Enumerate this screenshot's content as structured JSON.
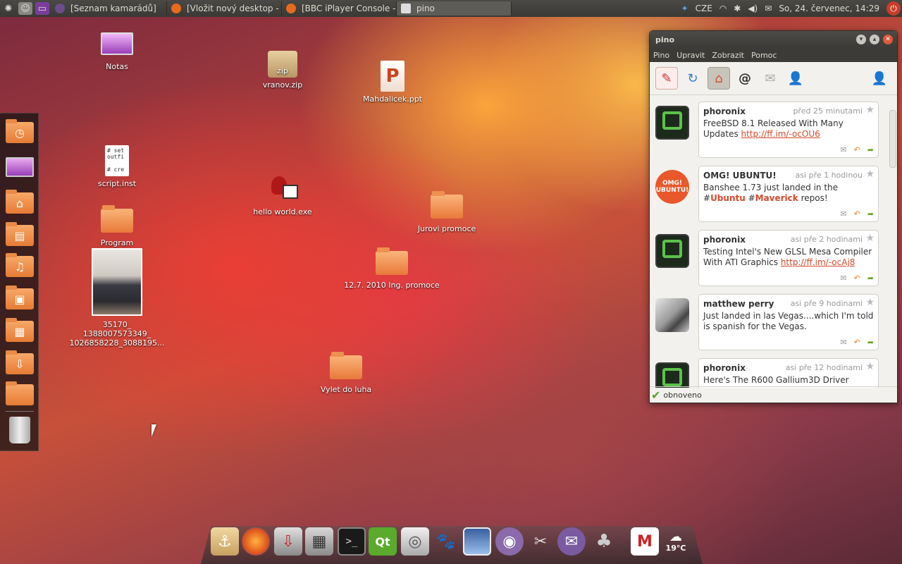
{
  "top_panel": {
    "tasks": [
      {
        "label": "[Seznam kamarádů]",
        "color": "#6b4d8a"
      },
      {
        "label": "[Vložit nový desktop - ...",
        "color": "#e86a1c"
      },
      {
        "label": "[BBC iPlayer Console -...",
        "color": "#e86a1c"
      },
      {
        "label": "pino",
        "color": "#dddddd"
      }
    ],
    "keyboard": "CZE",
    "clock": "So, 24. červenec, 14:29"
  },
  "desktop_icons": [
    {
      "label": "Notas"
    },
    {
      "label": "vranov.zip",
      "glyph": "zip"
    },
    {
      "label": "Mahdalicek.ppt",
      "glyph": "P"
    },
    {
      "label": "script.inst",
      "glyph": "# set\noutfi\n\n# cre"
    },
    {
      "label": "hello world.exe"
    },
    {
      "label": "Jurovi promoce"
    },
    {
      "label": "Program"
    },
    {
      "label": "12.7. 2010 Ing. promoce"
    },
    {
      "label_lines": [
        "35170_",
        "1388007573349_",
        "1026858228_3088195..."
      ]
    },
    {
      "label": "Vylet do luha"
    }
  ],
  "pino": {
    "title": "pino",
    "menu": [
      "Pino",
      "Upravit",
      "Zobrazit",
      "Pomoc"
    ],
    "tweets": [
      {
        "author": "phoronix",
        "time": "před 25 minutami",
        "text": "FreeBSD 8.1 Released With Many Updates ",
        "link": "http://ff.im/-ocOU6"
      },
      {
        "author": "OMG! UBUNTU!",
        "time": "asi pře 1 hodinou",
        "text_parts": [
          "Banshee 1.73 just landed in the #",
          "Ubuntu",
          " #",
          "Maverick",
          " repos!"
        ]
      },
      {
        "author": "phoronix",
        "time": "asi pře 2 hodinami",
        "text": "Testing Intel's New GLSL Mesa Compiler With ATI Graphics ",
        "link": "http://ff.im/-ocAj8"
      },
      {
        "author": "matthew perry",
        "time": "asi pře 9 hodinami",
        "text": "Just landed in las Vegas....which I'm told is spanish for the Vegas."
      },
      {
        "author": "phoronix",
        "time": "asi pře 12 hodinami",
        "text": "Here's The R600 Gallium3D Driver"
      }
    ],
    "avatar_text": "OMG! UBUNTU!",
    "status": "obnoveno"
  },
  "dock": {
    "weather": "19°C"
  }
}
